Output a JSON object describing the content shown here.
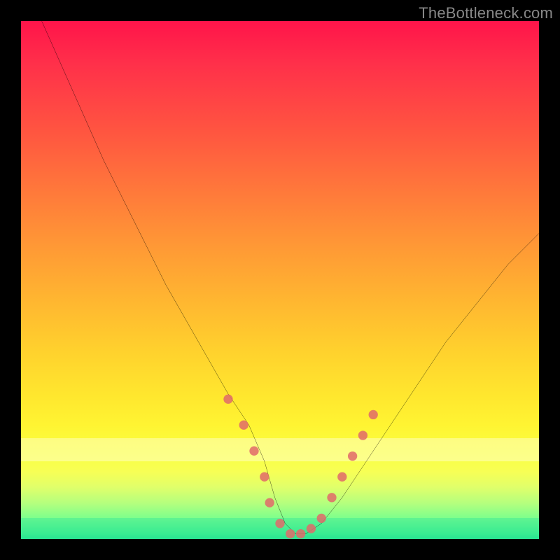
{
  "watermark": "TheBottleneck.com",
  "colors": {
    "frame": "#000000",
    "curve": "#000000",
    "marker": "#e06a6a",
    "gradient_top": "#ff144a",
    "gradient_bottom": "#19e08e"
  },
  "chart_data": {
    "type": "line",
    "title": "",
    "xlabel": "",
    "ylabel": "",
    "xlim": [
      0,
      100
    ],
    "ylim": [
      0,
      100
    ],
    "note": "Axes have no visible tick labels; x and y are normalized 0–100 estimates from gridless plot.",
    "series": [
      {
        "name": "bottleneck-curve",
        "x": [
          4,
          8,
          12,
          16,
          20,
          24,
          28,
          32,
          36,
          40,
          44,
          47,
          49,
          51,
          53,
          55,
          58,
          62,
          66,
          70,
          74,
          78,
          82,
          86,
          90,
          94,
          98,
          100
        ],
        "y": [
          100,
          91,
          82,
          73,
          65,
          57,
          49,
          42,
          35,
          28,
          22,
          15,
          8,
          3,
          1,
          1,
          3,
          8,
          14,
          20,
          26,
          32,
          38,
          43,
          48,
          53,
          57,
          59
        ]
      }
    ],
    "markers": {
      "name": "highlighted-points",
      "x": [
        40,
        43,
        45,
        47,
        48,
        50,
        52,
        54,
        56,
        58,
        60,
        62,
        64,
        66,
        68
      ],
      "y": [
        27,
        22,
        17,
        12,
        7,
        3,
        1,
        1,
        2,
        4,
        8,
        12,
        16,
        20,
        24
      ]
    },
    "bands": [
      {
        "name": "pale-band",
        "y_from": 14,
        "y_to": 19
      },
      {
        "name": "green-band",
        "y_from": 0,
        "y_to": 4
      }
    ]
  }
}
